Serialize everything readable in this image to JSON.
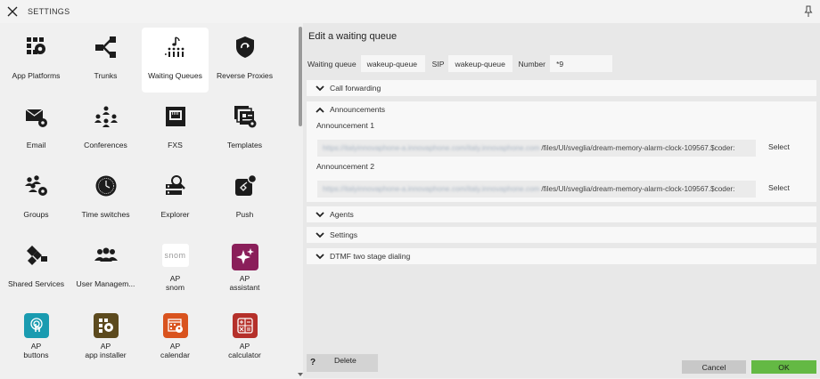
{
  "window": {
    "title": "SETTINGS"
  },
  "apps": [
    {
      "label": "App Platforms",
      "icon": "app-platforms-icon"
    },
    {
      "label": "Trunks",
      "icon": "trunks-icon"
    },
    {
      "label": "Waiting Queues",
      "icon": "waiting-queues-icon",
      "selected": true
    },
    {
      "label": "Reverse Proxies",
      "icon": "reverse-proxies-icon"
    },
    {
      "label": "Email",
      "icon": "email-icon"
    },
    {
      "label": "Conferences",
      "icon": "conferences-icon"
    },
    {
      "label": "FXS",
      "icon": "fxs-icon"
    },
    {
      "label": "Templates",
      "icon": "templates-icon"
    },
    {
      "label": "Groups",
      "icon": "groups-icon"
    },
    {
      "label": "Time switches",
      "icon": "time-switches-icon"
    },
    {
      "label": "Explorer",
      "icon": "explorer-icon"
    },
    {
      "label": "Push",
      "icon": "push-icon"
    },
    {
      "label": "Shared Services",
      "icon": "shared-services-icon"
    },
    {
      "label": "User Managem...",
      "icon": "user-management-icon"
    },
    {
      "label": "AP\nsnom",
      "icon": "snom-icon",
      "logo_text": "snom"
    },
    {
      "label": "AP\nassistant",
      "icon": "assistant-icon"
    },
    {
      "label": "AP\nbuttons",
      "icon": "buttons-icon"
    },
    {
      "label": "AP\napp installer",
      "icon": "app-installer-icon"
    },
    {
      "label": "AP\ncalendar",
      "icon": "calendar-icon"
    },
    {
      "label": "AP\ncalculator",
      "icon": "calculator-icon"
    }
  ],
  "panel": {
    "title": "Edit a waiting queue",
    "fields": {
      "waiting_queue_label": "Waiting queue",
      "waiting_queue_value": "wakeup-queue",
      "sip_label": "SIP",
      "sip_value": "wakeup-queue",
      "number_label": "Number",
      "number_value": "*9"
    },
    "sections": {
      "call_forwarding": "Call forwarding",
      "announcements": "Announcements",
      "agents": "Agents",
      "settings": "Settings",
      "dtmf": "DTMF two stage dialing"
    },
    "announcements": [
      {
        "label": "Announcement 1",
        "url_hidden": "https://italyinnovaphone-a.innovaphone.com/italy.innovaphone.com",
        "url_visible": "/files/UI/sveglia/dream-memory-alarm-clock-109567.$coder:",
        "select_label": "Select"
      },
      {
        "label": "Announcement 2",
        "url_hidden": "https://italyinnovaphone-a.innovaphone.com/italy.innovaphone.com",
        "url_visible": "/files/UI/sveglia/dream-memory-alarm-clock-109567.$coder:",
        "select_label": "Select"
      }
    ]
  },
  "footer": {
    "help_label": "?",
    "delete_label": "Delete",
    "cancel_label": "Cancel",
    "ok_label": "OK"
  },
  "colors": {
    "ok_green": "#64b944",
    "icon_dark": "#1c1c1c",
    "assistant_purple": "#8a1f5a",
    "buttons_teal": "#1a9bb0",
    "installer_olive": "#5c4a1e",
    "calendar_orange": "#d9531e",
    "calculator_red": "#b5302a"
  }
}
